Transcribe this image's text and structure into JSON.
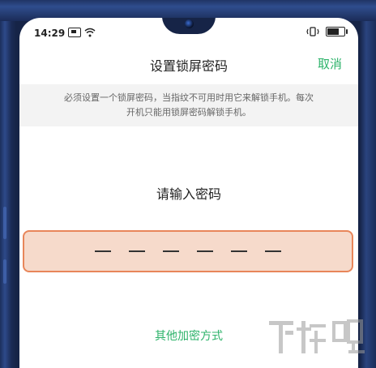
{
  "status_bar": {
    "time": "14:29",
    "icons": [
      "sim-card-icon",
      "wifi-icon",
      "vibrate-icon",
      "battery-icon"
    ],
    "battery_level": 0.8
  },
  "header": {
    "title": "设置锁屏密码",
    "cancel_label": "取消"
  },
  "notice": {
    "line1": "必须设置一个锁屏密码，当指纹不可用时用它来解锁手机。每次",
    "line2": "开机只能用锁屏密码解锁手机。"
  },
  "password": {
    "prompt": "请输入密码",
    "digits": 6,
    "entered": 0
  },
  "other_method_label": "其他加密方式",
  "watermark": {
    "text": "下载吧"
  },
  "colors": {
    "accent": "#2db36a",
    "input_fill": "#f6dacb",
    "input_border": "#e8865a",
    "notice_bg": "#f3f3f3",
    "frame": "#1c2f5c"
  }
}
